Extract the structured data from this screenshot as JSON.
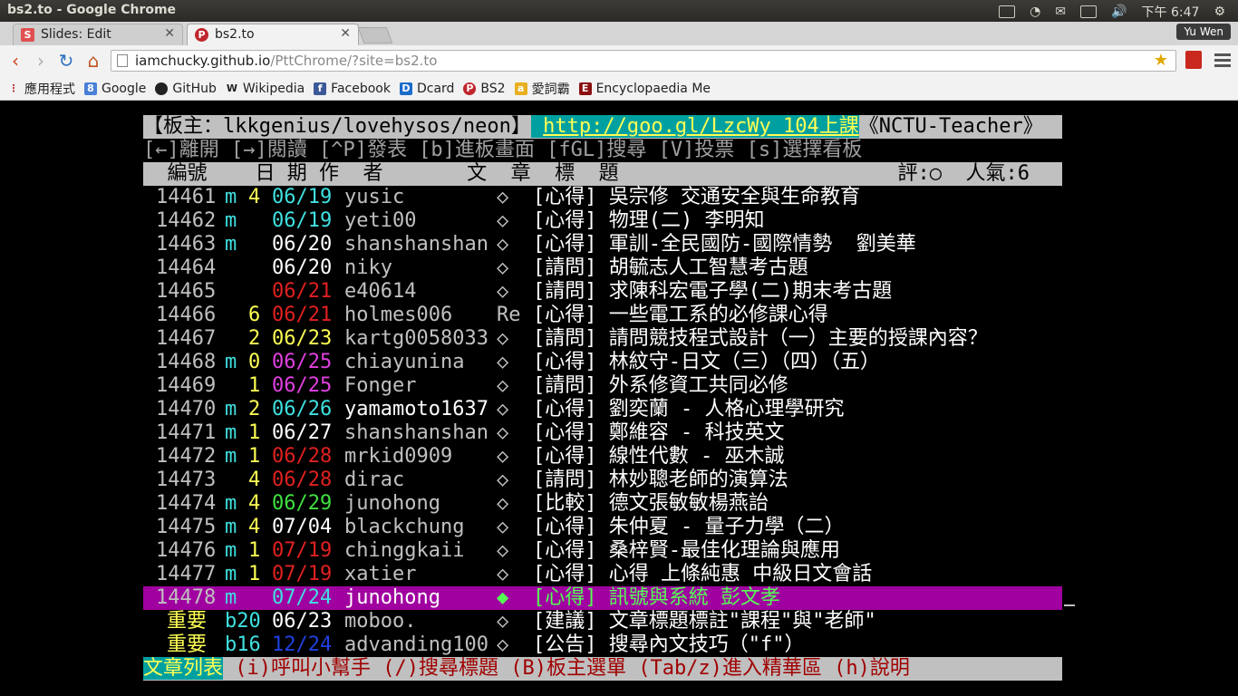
{
  "os": {
    "window_title": "bs2.to - Google Chrome",
    "clock": "下午 6:47"
  },
  "tabs": [
    {
      "label": "Slides: Edit",
      "favicon": "S",
      "favicon_color": "#e05050"
    },
    {
      "label": "bs2.to",
      "favicon": "P",
      "favicon_color": "#c0272d"
    }
  ],
  "user": "Yu Wen",
  "omnibox": {
    "host": "iamchucky.github.io",
    "path": "/PttChrome/?site=bs2.to"
  },
  "bookmarks": [
    {
      "label": "應用程式",
      "icon": "apps-icon"
    },
    {
      "label": "Google",
      "icon": "google-icon"
    },
    {
      "label": "GitHub",
      "icon": "github-icon"
    },
    {
      "label": "Wikipedia",
      "icon": "wikipedia-icon"
    },
    {
      "label": "Facebook",
      "icon": "facebook-icon"
    },
    {
      "label": "Dcard",
      "icon": "dcard-icon"
    },
    {
      "label": "BS2",
      "icon": "bs2-icon"
    },
    {
      "label": "愛詞霸",
      "icon": "iciba-icon"
    },
    {
      "label": "Encyclopaedia Me",
      "icon": "encyclopaedia-icon"
    }
  ],
  "board": {
    "moderators": "【板主：lkkgenius/lovehysos/neon】",
    "link": "http://goo.gl/LzcWy 104上課",
    "board_name": "《NCTU-Teacher》",
    "commands": "[←]離開 [→]閱讀 [^P]發表 [b]進板畫面 [fGL]搜尋 [V]投票 [s]選擇看板",
    "columns": "  編號    日 期 作  者       文  章  標  題",
    "rating": "評:○  人氣:6"
  },
  "posts": [
    {
      "num": "14461",
      "mark": "m",
      "count": "4",
      "date": "06/19",
      "date_color": "#40e0e0",
      "author": "yusic",
      "sym": "◇",
      "title": "[心得] 吳宗修 交通安全與生命教育"
    },
    {
      "num": "14462",
      "mark": "m",
      "count": "",
      "date": "06/19",
      "date_color": "#40e0e0",
      "author": "yeti00",
      "sym": "◇",
      "title": "[心得] 物理(二) 李明知"
    },
    {
      "num": "14463",
      "mark": "m",
      "count": "",
      "date": "06/20",
      "date_color": "#ffffff",
      "author": "shanshanshan",
      "sym": "◇",
      "title": "[心得] 軍訓-全民國防-國際情勢  劉美華"
    },
    {
      "num": "14464",
      "mark": "",
      "count": "",
      "date": "06/20",
      "date_color": "#ffffff",
      "author": "niky",
      "sym": "◇",
      "title": "[請問] 胡毓志人工智慧考古題"
    },
    {
      "num": "14465",
      "mark": "",
      "count": "",
      "date": "06/21",
      "date_color": "#e02020",
      "author": "e40614",
      "sym": "◇",
      "title": "[請問] 求陳科宏電子學(二)期末考古題"
    },
    {
      "num": "14466",
      "mark": "",
      "count": "6",
      "date": "06/21",
      "date_color": "#e02020",
      "author": "holmes006",
      "sym": "Re",
      "title": "[心得] 一些電工系的必修課心得"
    },
    {
      "num": "14467",
      "mark": "",
      "count": "2",
      "date": "06/23",
      "date_color": "#ffff54",
      "author": "kartg0058033",
      "sym": "◇",
      "title": "[請問] 請問競技程式設計（一）主要的授課內容？"
    },
    {
      "num": "14468",
      "mark": "m",
      "count": "0",
      "date": "06/25",
      "date_color": "#e040e0",
      "author": "chiayunina",
      "sym": "◇",
      "title": "[心得] 林紋守-日文（三）（四）（五）"
    },
    {
      "num": "14469",
      "mark": "",
      "count": "1",
      "date": "06/25",
      "date_color": "#e040e0",
      "author": "Fonger",
      "sym": "◇",
      "title": "[請問] 外系修資工共同必修"
    },
    {
      "num": "14470",
      "mark": "m",
      "count": "2",
      "date": "06/26",
      "date_color": "#40e0e0",
      "author": "yamamoto1637",
      "author_color": "#ffffff",
      "sym": "◇",
      "title": "[心得] 劉奕蘭 - 人格心理學研究"
    },
    {
      "num": "14471",
      "mark": "m",
      "count": "1",
      "date": "06/27",
      "date_color": "#ffffff",
      "author": "shanshanshan",
      "sym": "◇",
      "title": "[心得] 鄭維容 - 科技英文"
    },
    {
      "num": "14472",
      "mark": "m",
      "count": "1",
      "date": "06/28",
      "date_color": "#e02020",
      "author": "mrkid0909",
      "sym": "◇",
      "title": "[心得] 線性代數 - 巫木誠"
    },
    {
      "num": "14473",
      "mark": "",
      "count": "4",
      "date": "06/28",
      "date_color": "#e02020",
      "author": "dirac",
      "sym": "◇",
      "title": "[請問] 林妙聰老師的演算法"
    },
    {
      "num": "14474",
      "mark": "m",
      "count": "4",
      "date": "06/29",
      "date_color": "#40e040",
      "author": "junohong",
      "sym": "◇",
      "title": "[比較] 德文張敏敏楊燕詒"
    },
    {
      "num": "14475",
      "mark": "m",
      "count": "4",
      "date": "07/04",
      "date_color": "#ffffff",
      "author": "blackchung",
      "sym": "◇",
      "title": "[心得] 朱仲夏 - 量子力學（二）"
    },
    {
      "num": "14476",
      "mark": "m",
      "count": "1",
      "date": "07/19",
      "date_color": "#e02020",
      "author": "chinggkaii",
      "sym": "◇",
      "title": "[心得] 桑梓賢-最佳化理論與應用"
    },
    {
      "num": "14477",
      "mark": "m",
      "count": "1",
      "date": "07/19",
      "date_color": "#e02020",
      "author": "xatier",
      "sym": "◇",
      "title": "[心得] 心得 上條純惠 中級日文會話"
    },
    {
      "num": "14478",
      "mark": "m",
      "count": "",
      "date": "07/24",
      "date_color": "#40e0e0",
      "author": "junohong",
      "author_color": "#ffffff",
      "sym": "◆",
      "title": "[心得] 訊號與系統 彭文孝",
      "selected": true
    },
    {
      "num": "重要",
      "mark": "b20",
      "count": "",
      "date": "06/23",
      "date_color": "#ffffff",
      "author": "moboo.",
      "sym": "◇",
      "title": "[建議] 文章標題標註\"課程\"與\"老師\"",
      "important": true
    },
    {
      "num": "重要",
      "mark": "b16",
      "count": "",
      "date": "12/24",
      "date_color": "#2040e0",
      "author": "advanding100",
      "sym": "◇",
      "title": "[公告] 搜尋內文技巧（\"f\"）",
      "important": true
    }
  ],
  "footer": {
    "label": "文章列表",
    "help": " (i)呼叫小幫手 (/)搜尋標題 (B)板主選單 (Tab/z)進入精華區 (h)說明"
  }
}
